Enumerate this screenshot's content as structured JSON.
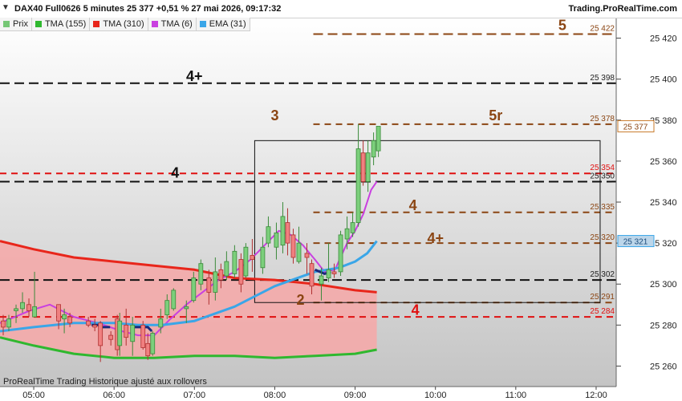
{
  "header": {
    "collapse_icon": "triangle-down-icon",
    "title": "DAX40 Full0626 5 minutes 25 377 +0,51 % 27 mai 2026, 09:17:32",
    "brand": "Trading.ProRealTime.com"
  },
  "legend": [
    {
      "label": "Prix",
      "color": "#76c776"
    },
    {
      "label": "TMA (155)",
      "color": "#2fb82f"
    },
    {
      "label": "TMA (310)",
      "color": "#e8261b"
    },
    {
      "label": "TMA (6)",
      "color": "#c940e0"
    },
    {
      "label": "EMA (31)",
      "color": "#3aa6e8"
    }
  ],
  "footer": {
    "text": "ProRealTime Trading  Historique ajusté aux rollovers"
  },
  "chart_data": {
    "type": "candlestick",
    "x_axis": {
      "labels": [
        "05:00",
        "06:00",
        "07:00",
        "08:00",
        "09:00",
        "10:00",
        "11:00",
        "12:00"
      ],
      "start_hour": 4.58,
      "end_hour": 12.25
    },
    "y_axis": {
      "range": [
        25250,
        25430
      ],
      "ticks": [
        25260,
        25280,
        25300,
        25320,
        25340,
        25360,
        25380,
        25400,
        25420
      ]
    },
    "current_price": {
      "value": 25377,
      "label": "25 377"
    },
    "ema_last": {
      "value": 25321,
      "label": "25 321"
    },
    "candles": [
      {
        "t": 4.62,
        "o": 25282,
        "h": 25285,
        "l": 25275,
        "c": 25279
      },
      {
        "t": 4.69,
        "o": 25279,
        "h": 25285,
        "l": 25277,
        "c": 25283
      },
      {
        "t": 4.78,
        "o": 25287,
        "h": 25290,
        "l": 25281,
        "c": 25288
      },
      {
        "t": 4.86,
        "o": 25288,
        "h": 25296,
        "l": 25286,
        "c": 25291
      },
      {
        "t": 4.94,
        "o": 25290,
        "h": 25293,
        "l": 25284,
        "c": 25287
      },
      {
        "t": 5.01,
        "o": 25284,
        "h": 25306,
        "l": 25284,
        "c": 25289
      },
      {
        "t": 5.31,
        "o": 25290,
        "h": 25290,
        "l": 25278,
        "c": 25282
      },
      {
        "t": 5.38,
        "o": 25283,
        "h": 25288,
        "l": 25276,
        "c": 25285
      },
      {
        "t": 5.45,
        "o": 25284,
        "h": 25286,
        "l": 25279,
        "c": 25281
      },
      {
        "t": 5.68,
        "o": 25282,
        "h": 25284,
        "l": 25279,
        "c": 25280
      },
      {
        "t": 5.76,
        "o": 25280,
        "h": 25283,
        "l": 25277,
        "c": 25279
      },
      {
        "t": 5.83,
        "o": 25281,
        "h": 25282,
        "l": 25262,
        "c": 25270
      },
      {
        "t": 5.96,
        "o": 25275,
        "h": 25277,
        "l": 25270,
        "c": 25273
      },
      {
        "t": 6.04,
        "o": 25283,
        "h": 25285,
        "l": 25265,
        "c": 25268
      },
      {
        "t": 6.07,
        "o": 25270,
        "h": 25286,
        "l": 25265,
        "c": 25282
      },
      {
        "t": 6.15,
        "o": 25280,
        "h": 25288,
        "l": 25270,
        "c": 25274
      },
      {
        "t": 6.23,
        "o": 25272,
        "h": 25284,
        "l": 25265,
        "c": 25280
      },
      {
        "t": 6.36,
        "o": 25280,
        "h": 25282,
        "l": 25268,
        "c": 25269
      },
      {
        "t": 6.42,
        "o": 25271,
        "h": 25276,
        "l": 25263,
        "c": 25265
      },
      {
        "t": 6.48,
        "o": 25266,
        "h": 25277,
        "l": 25265,
        "c": 25276
      },
      {
        "t": 6.58,
        "o": 25279,
        "h": 25288,
        "l": 25276,
        "c": 25283
      },
      {
        "t": 6.66,
        "o": 25285,
        "h": 25295,
        "l": 25283,
        "c": 25292
      },
      {
        "t": 6.74,
        "o": 25288,
        "h": 25298,
        "l": 25287,
        "c": 25297
      },
      {
        "t": 6.9,
        "o": 25288,
        "h": 25292,
        "l": 25281,
        "c": 25289
      },
      {
        "t": 6.99,
        "o": 25292,
        "h": 25306,
        "l": 25291,
        "c": 25303
      },
      {
        "t": 7.08,
        "o": 25300,
        "h": 25312,
        "l": 25297,
        "c": 25310
      },
      {
        "t": 7.18,
        "o": 25303,
        "h": 25307,
        "l": 25290,
        "c": 25296
      },
      {
        "t": 7.26,
        "o": 25296,
        "h": 25313,
        "l": 25292,
        "c": 25306
      },
      {
        "t": 7.33,
        "o": 25307,
        "h": 25310,
        "l": 25298,
        "c": 25302
      },
      {
        "t": 7.4,
        "o": 25304,
        "h": 25316,
        "l": 25302,
        "c": 25311
      },
      {
        "t": 7.5,
        "o": 25305,
        "h": 25319,
        "l": 25303,
        "c": 25316
      },
      {
        "t": 7.58,
        "o": 25312,
        "h": 25315,
        "l": 25296,
        "c": 25300
      },
      {
        "t": 7.64,
        "o": 25304,
        "h": 25320,
        "l": 25303,
        "c": 25318
      },
      {
        "t": 7.72,
        "o": 25314,
        "h": 25322,
        "l": 25306,
        "c": 25312
      },
      {
        "t": 7.85,
        "o": 25308,
        "h": 25323,
        "l": 25305,
        "c": 25318
      },
      {
        "t": 7.92,
        "o": 25320,
        "h": 25333,
        "l": 25318,
        "c": 25328
      },
      {
        "t": 8.02,
        "o": 25318,
        "h": 25330,
        "l": 25312,
        "c": 25325
      },
      {
        "t": 8.1,
        "o": 25319,
        "h": 25340,
        "l": 25315,
        "c": 25333
      },
      {
        "t": 8.16,
        "o": 25330,
        "h": 25337,
        "l": 25314,
        "c": 25320
      },
      {
        "t": 8.23,
        "o": 25324,
        "h": 25327,
        "l": 25310,
        "c": 25313
      },
      {
        "t": 8.3,
        "o": 25311,
        "h": 25328,
        "l": 25310,
        "c": 25320
      },
      {
        "t": 8.4,
        "o": 25315,
        "h": 25320,
        "l": 25305,
        "c": 25313
      },
      {
        "t": 8.46,
        "o": 25310,
        "h": 25312,
        "l": 25295,
        "c": 25299
      },
      {
        "t": 8.58,
        "o": 25300,
        "h": 25308,
        "l": 25292,
        "c": 25304
      },
      {
        "t": 8.67,
        "o": 25303,
        "h": 25320,
        "l": 25301,
        "c": 25307
      },
      {
        "t": 8.74,
        "o": 25306,
        "h": 25310,
        "l": 25303,
        "c": 25305
      },
      {
        "t": 8.82,
        "o": 25306,
        "h": 25326,
        "l": 25304,
        "c": 25324
      },
      {
        "t": 8.9,
        "o": 25322,
        "h": 25333,
        "l": 25317,
        "c": 25327
      },
      {
        "t": 8.97,
        "o": 25325,
        "h": 25335,
        "l": 25323,
        "c": 25330
      },
      {
        "t": 9.04,
        "o": 25330,
        "h": 25378,
        "l": 25328,
        "c": 25366
      },
      {
        "t": 9.1,
        "o": 25364,
        "h": 25370,
        "l": 25348,
        "c": 25350
      },
      {
        "t": 9.16,
        "o": 25350,
        "h": 25370,
        "l": 25345,
        "c": 25364
      },
      {
        "t": 9.23,
        "o": 25362,
        "h": 25374,
        "l": 25358,
        "c": 25370
      },
      {
        "t": 9.29,
        "o": 25365,
        "h": 25377,
        "l": 25362,
        "c": 25377
      }
    ],
    "series": [
      {
        "name": "TMA (155)",
        "color": "#2fb82f",
        "points": [
          [
            4.58,
            25274
          ],
          [
            5.0,
            25270
          ],
          [
            5.5,
            25266
          ],
          [
            6.0,
            25264
          ],
          [
            6.5,
            25264
          ],
          [
            7.0,
            25265
          ],
          [
            7.5,
            25265
          ],
          [
            8.0,
            25264
          ],
          [
            8.5,
            25265
          ],
          [
            9.0,
            25266
          ],
          [
            9.27,
            25268
          ]
        ]
      },
      {
        "name": "TMA (310)",
        "color": "#e8261b",
        "points": [
          [
            4.58,
            25321
          ],
          [
            5.0,
            25317
          ],
          [
            5.5,
            25313
          ],
          [
            6.0,
            25311
          ],
          [
            6.5,
            25309
          ],
          [
            7.0,
            25307
          ],
          [
            7.5,
            25303
          ],
          [
            8.0,
            25302
          ],
          [
            8.5,
            25300
          ],
          [
            9.0,
            25297
          ],
          [
            9.27,
            25296
          ]
        ]
      },
      {
        "name": "TMA (6)",
        "color": "#c940e0",
        "points": [
          [
            4.58,
            25281
          ],
          [
            4.95,
            25287
          ],
          [
            5.2,
            25290
          ],
          [
            5.5,
            25284
          ],
          [
            5.8,
            25281
          ],
          [
            6.1,
            25277
          ],
          [
            6.3,
            25275
          ],
          [
            6.5,
            25275
          ],
          [
            6.7,
            25283
          ],
          [
            6.9,
            25290
          ],
          [
            7.1,
            25296
          ],
          [
            7.3,
            25302
          ],
          [
            7.5,
            25306
          ],
          [
            7.7,
            25312
          ],
          [
            7.9,
            25320
          ],
          [
            8.05,
            25326
          ],
          [
            8.2,
            25324
          ],
          [
            8.35,
            25319
          ],
          [
            8.5,
            25312
          ],
          [
            8.62,
            25306
          ],
          [
            8.75,
            25307
          ],
          [
            8.9,
            25320
          ],
          [
            9.0,
            25326
          ],
          [
            9.1,
            25334
          ],
          [
            9.2,
            25346
          ],
          [
            9.27,
            25350
          ]
        ]
      },
      {
        "name": "EMA (31)",
        "color": "#3aa6e8",
        "points": [
          [
            4.58,
            25277
          ],
          [
            5.0,
            25279
          ],
          [
            5.5,
            25281
          ],
          [
            6.0,
            25281
          ],
          [
            6.3,
            25280
          ],
          [
            6.6,
            25280
          ],
          [
            7.0,
            25282
          ],
          [
            7.5,
            25289
          ],
          [
            8.0,
            25299
          ],
          [
            8.5,
            25306
          ],
          [
            8.8,
            25308
          ],
          [
            9.0,
            25311
          ],
          [
            9.15,
            25315
          ],
          [
            9.27,
            25321
          ]
        ]
      }
    ],
    "bands": [
      {
        "between": [
          "TMA (155)",
          "TMA (310)"
        ],
        "color": "#f4aaaa",
        "x": [
          4.58,
          9.27
        ]
      }
    ],
    "highlight_segments": [
      {
        "color": "#1a2a7a",
        "points": [
          [
            5.72,
            25280
          ],
          [
            5.83,
            25280
          ],
          [
            5.85,
            25279
          ],
          [
            5.95,
            25279
          ]
        ]
      },
      {
        "color": "#1a2a7a",
        "points": [
          [
            6.22,
            25279
          ],
          [
            6.42,
            25279
          ],
          [
            6.47,
            25277
          ]
        ]
      },
      {
        "color": "#1a2a7a",
        "points": [
          [
            8.5,
            25307
          ],
          [
            8.62,
            25305
          ],
          [
            8.7,
            25306
          ]
        ]
      }
    ],
    "levels": [
      {
        "value": 25422,
        "label": "25 422",
        "color": "#8b4513",
        "dash": "long",
        "x_start": 8.48
      },
      {
        "value": 25398,
        "label": "25 398",
        "color": "#111111",
        "dash": "long",
        "x_start": 4.58
      },
      {
        "value": 25378,
        "label": "25 378",
        "color": "#8b4513",
        "dash": "short",
        "x_start": 8.48
      },
      {
        "value": 25354,
        "label": "25 354",
        "color": "#e01010",
        "dash": "short",
        "x_start": 4.58
      },
      {
        "value": 25350,
        "label": "25 350",
        "color": "#111111",
        "dash": "long",
        "x_start": 4.58
      },
      {
        "value": 25335,
        "label": "25 335",
        "color": "#8b4513",
        "dash": "short",
        "x_start": 8.48
      },
      {
        "value": 25320,
        "label": "25 320",
        "color": "#8b4513",
        "dash": "short",
        "x_start": 8.48
      },
      {
        "value": 25302,
        "label": "25 302",
        "color": "#111111",
        "dash": "long",
        "x_start": 4.58
      },
      {
        "value": 25291,
        "label": "25 291",
        "color": "#8b4513",
        "dash": "short",
        "x_start": 8.48
      },
      {
        "value": 25284,
        "label": "25 284",
        "color": "#e01010",
        "dash": "short",
        "x_start": 4.58
      }
    ],
    "rectangle": {
      "x0": 7.75,
      "x1": 12.05,
      "y0": 25291,
      "y1": 25370,
      "color": "#111111"
    },
    "annotations": [
      {
        "text": "5",
        "x": 11.58,
        "y": 25424,
        "color": "#8b4513"
      },
      {
        "text": "4+",
        "x": 7.0,
        "y": 25399,
        "color": "#111111"
      },
      {
        "text": "3",
        "x": 8.0,
        "y": 25380,
        "color": "#8b4513"
      },
      {
        "text": "5r",
        "x": 10.75,
        "y": 25380,
        "color": "#8b4513"
      },
      {
        "text": "4",
        "x": 6.76,
        "y": 25352,
        "color": "#111111"
      },
      {
        "text": "4",
        "x": 9.72,
        "y": 25336,
        "color": "#8b4513"
      },
      {
        "text": "4+",
        "x": 10.0,
        "y": 25320,
        "color": "#8b4513"
      },
      {
        "text": "2",
        "x": 8.32,
        "y": 25290,
        "color": "#8b4513"
      },
      {
        "text": "4",
        "x": 9.75,
        "y": 25285,
        "color": "#e01010"
      }
    ]
  }
}
